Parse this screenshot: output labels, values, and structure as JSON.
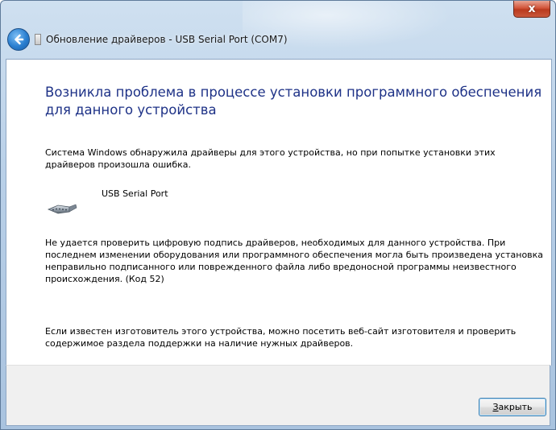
{
  "window": {
    "title": "Обновление драйверов - USB Serial Port (COM7)",
    "close_glyph": "x"
  },
  "content": {
    "heading": "Возникла проблема в процессе установки программного обеспечения для данного устройства",
    "intro": "Система Windows обнаружила драйверы для этого устройства, но при попытке установки этих драйверов произошла ошибка.",
    "device_name": "USB Serial Port",
    "error_text": "Не удается проверить цифровую подпись драйверов, необходимых для данного устройства. При последнем изменении оборудования или программного обеспечения могла быть произведена установка неправильно подписанного или поврежденного файла либо вредоносной программы неизвестного происхождения. (Код 52)",
    "hint_text": "Если известен изготовитель этого устройства, можно посетить веб-сайт изготовителя и проверить содержимое раздела поддержки на наличие нужных драйверов."
  },
  "footer": {
    "close_accel": "З",
    "close_rest": "акрыть"
  },
  "colors": {
    "heading": "#1e3287",
    "accent": "#3c7fb1"
  },
  "icons": {
    "back": "back-arrow-icon",
    "device": "serial-cable-icon"
  }
}
